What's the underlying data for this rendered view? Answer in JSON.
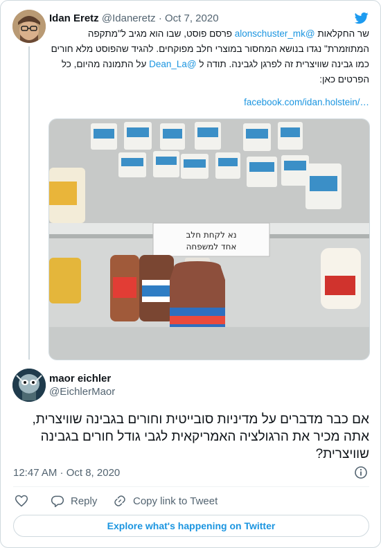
{
  "quoted_tweet": {
    "author_name": "Idan Eretz",
    "author_handle": "@Idaneretz",
    "separator": "·",
    "date": "Oct 7, 2020",
    "text_part1": "שר החקלאות ",
    "mention1": "@alonschuster_mk",
    "text_part2": " פרסם פוסט, שבו הוא מגיב ל\"מתקפה המתוזמרת\" נגדו בנושא המחסור במוצרי חלב מפוקחים. להגיד שהפוסט מלא חורים כמו גבינה שוויצרית זה לפרגן לגבינה. תודה ל ",
    "mention2": "@Dean_La",
    "text_part3": " על התמונה מהיום, כל הפרטים כאן:",
    "link": "facebook.com/idan.holstein/…",
    "photo_sign_line1": "נא לקחת חלב",
    "photo_sign_line2": "אחד למשפחה"
  },
  "main_tweet": {
    "author_name": "maor eichler",
    "author_handle": "@EichlerMaor",
    "text": "אם כבר מדברים על מדיניות סובייטית וחורים בגבינה שוויצרית, אתה מכיר את הרגולציה האמריקאית לגבי גודל חורים בגבינה שוויצרית?",
    "timestamp": "12:47 AM · Oct 8, 2020"
  },
  "actions": {
    "reply_label": "Reply",
    "copy_label": "Copy link to Tweet"
  },
  "explore_label": "Explore what's happening on Twitter",
  "colors": {
    "link_blue": "#1b95e0",
    "muted_gray": "#536471",
    "border": "#cfd9de",
    "twitter_blue": "#1d9bf0"
  },
  "icons": [
    "twitter-bird-icon",
    "info-icon",
    "heart-icon",
    "reply-icon",
    "link-icon"
  ]
}
